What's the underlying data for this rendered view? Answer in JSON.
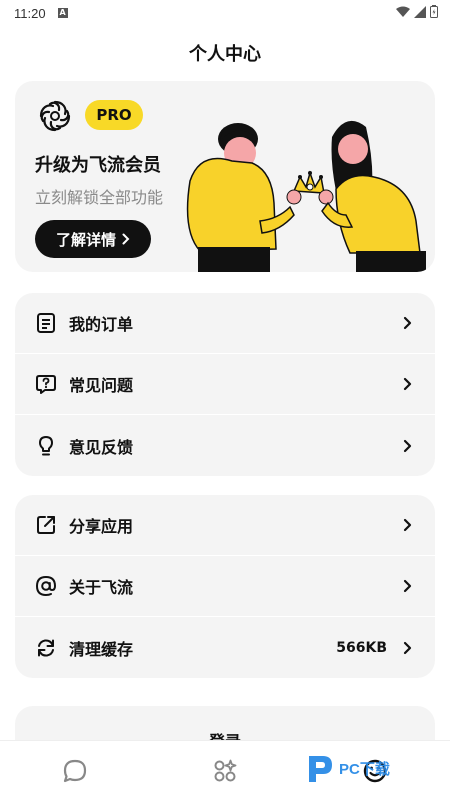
{
  "status_bar": {
    "time": "11:20",
    "notif_glyph": "A"
  },
  "page": {
    "title": "个人中心"
  },
  "pro_card": {
    "badge": "PRO",
    "title": "升级为飞流会员",
    "subtitle": "立刻解锁全部功能",
    "button_label": "了解详情",
    "logo_icon": "swirl-logo-icon",
    "badge_color": "#f8d927"
  },
  "menu_group_1": [
    {
      "label": "我的订单",
      "icon": "order-list-icon"
    },
    {
      "label": "常见问题",
      "icon": "faq-question-icon"
    },
    {
      "label": "意见反馈",
      "icon": "lightbulb-icon"
    }
  ],
  "menu_group_2": [
    {
      "label": "分享应用",
      "icon": "share-icon"
    },
    {
      "label": "关于飞流",
      "icon": "at-icon"
    },
    {
      "label": "清理缓存",
      "icon": "refresh-icon",
      "value": "566KB"
    }
  ],
  "login": {
    "label": "登录"
  },
  "bottom_nav": [
    {
      "icon": "chat-bubble-icon"
    },
    {
      "icon": "apps-grid-icon"
    },
    {
      "icon": "profile-smile-icon"
    }
  ],
  "watermark": {
    "text": "PC下载"
  }
}
